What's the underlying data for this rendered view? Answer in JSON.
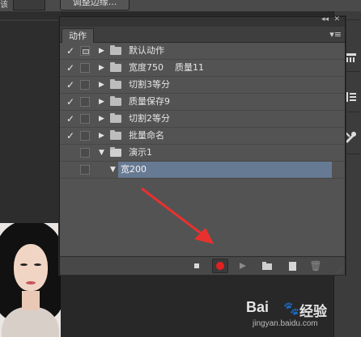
{
  "options_bar": {
    "label": "该",
    "refine_button_label": "调整边缘..."
  },
  "panel": {
    "tab_label": "动作",
    "collapse_glyph": "◂◂",
    "close_glyph": "✕",
    "menu_glyph": "▾≡",
    "rows": [
      {
        "checked": true,
        "dialog": true,
        "expanded": false,
        "name": "默认动作"
      },
      {
        "checked": true,
        "dialog": false,
        "expanded": false,
        "name": "宽度750    质量11"
      },
      {
        "checked": true,
        "dialog": false,
        "expanded": false,
        "name": "切割3等分"
      },
      {
        "checked": true,
        "dialog": false,
        "expanded": false,
        "name": "质量保存9"
      },
      {
        "checked": true,
        "dialog": false,
        "expanded": false,
        "name": "切割2等分"
      },
      {
        "checked": true,
        "dialog": false,
        "expanded": false,
        "name": "批量命名"
      },
      {
        "checked": false,
        "dialog": false,
        "expanded": true,
        "name": "演示1"
      },
      {
        "checked": false,
        "dialog": false,
        "expanded": true,
        "name": "宽200",
        "selected": true,
        "level": 2
      }
    ],
    "check_glyph": "✓",
    "collapsed_arrow": "▶",
    "expanded_arrow": "▼",
    "footer": {
      "stop_label": "",
      "record_state": "recording",
      "trash_glyph": "🗑"
    }
  },
  "watermark": {
    "logo": "Bai",
    "logo_tail": "经验",
    "paw": "🐾",
    "url": "jingyan.baidu.com"
  },
  "colors": {
    "record_red": "#e32020",
    "selection_blue": "#677a93",
    "panel_bg": "#535353",
    "annotation_arrow": "#e8312f"
  }
}
